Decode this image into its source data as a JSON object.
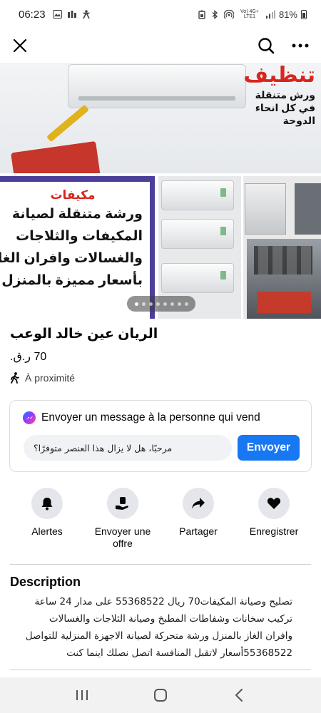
{
  "status_bar": {
    "time": "06:23",
    "network": "Vo) 4G+ LTE1",
    "battery": "81%"
  },
  "header": {
    "close_icon": "close-icon",
    "search_icon": "search-icon",
    "more_icon": "more-icon"
  },
  "banner": {
    "headline": "تنظيف",
    "lines": [
      "ورش متنقلة",
      "في كل انحاء",
      "الدوحة"
    ]
  },
  "flyer": {
    "heading": "مكيفات",
    "lines": [
      "ورشة متنقلة لصيانة",
      "المكيفات والثلاجات",
      "والغسالات وافران الغاز",
      "بأسعار مميزة بالمنزل"
    ]
  },
  "carousel": {
    "pages": 8,
    "current": 0
  },
  "listing": {
    "title": "الريان عين خالد الوعب",
    "price": "70 ر.ق.",
    "location": "À proximité"
  },
  "message": {
    "heading": "Envoyer un message à la personne qui vend",
    "input_value": "مرحبًا، هل لا يزال هذا العنصر متوفرًا؟",
    "send_label": "Envoyer"
  },
  "actions": [
    {
      "label": "Alertes",
      "icon": "bell-icon"
    },
    {
      "label": "Envoyer une offre",
      "icon": "offer-icon"
    },
    {
      "label": "Partager",
      "icon": "share-icon"
    },
    {
      "label": "Enregistrer",
      "icon": "heart-icon"
    }
  ],
  "description": {
    "heading": "Description",
    "lines": [
      "تصليح وصيانة المكيفات70 ريال  55368522 على مدار 24 ساعة",
      "تركيب سخانات وشفاطات  المطبخ وصيانة الثلاجات والغسالات",
      "وافران الغاز بالمنزل ورشة متحركة لصيانة الاجهزة المنزلية للتواصل",
      "55368522أسعار لاتقبل المنافسة اتصل نصلك اينما كنت"
    ]
  },
  "nav_bar": {
    "recent_icon": "recent-apps-icon",
    "home_icon": "home-icon",
    "back_icon": "back-icon"
  }
}
